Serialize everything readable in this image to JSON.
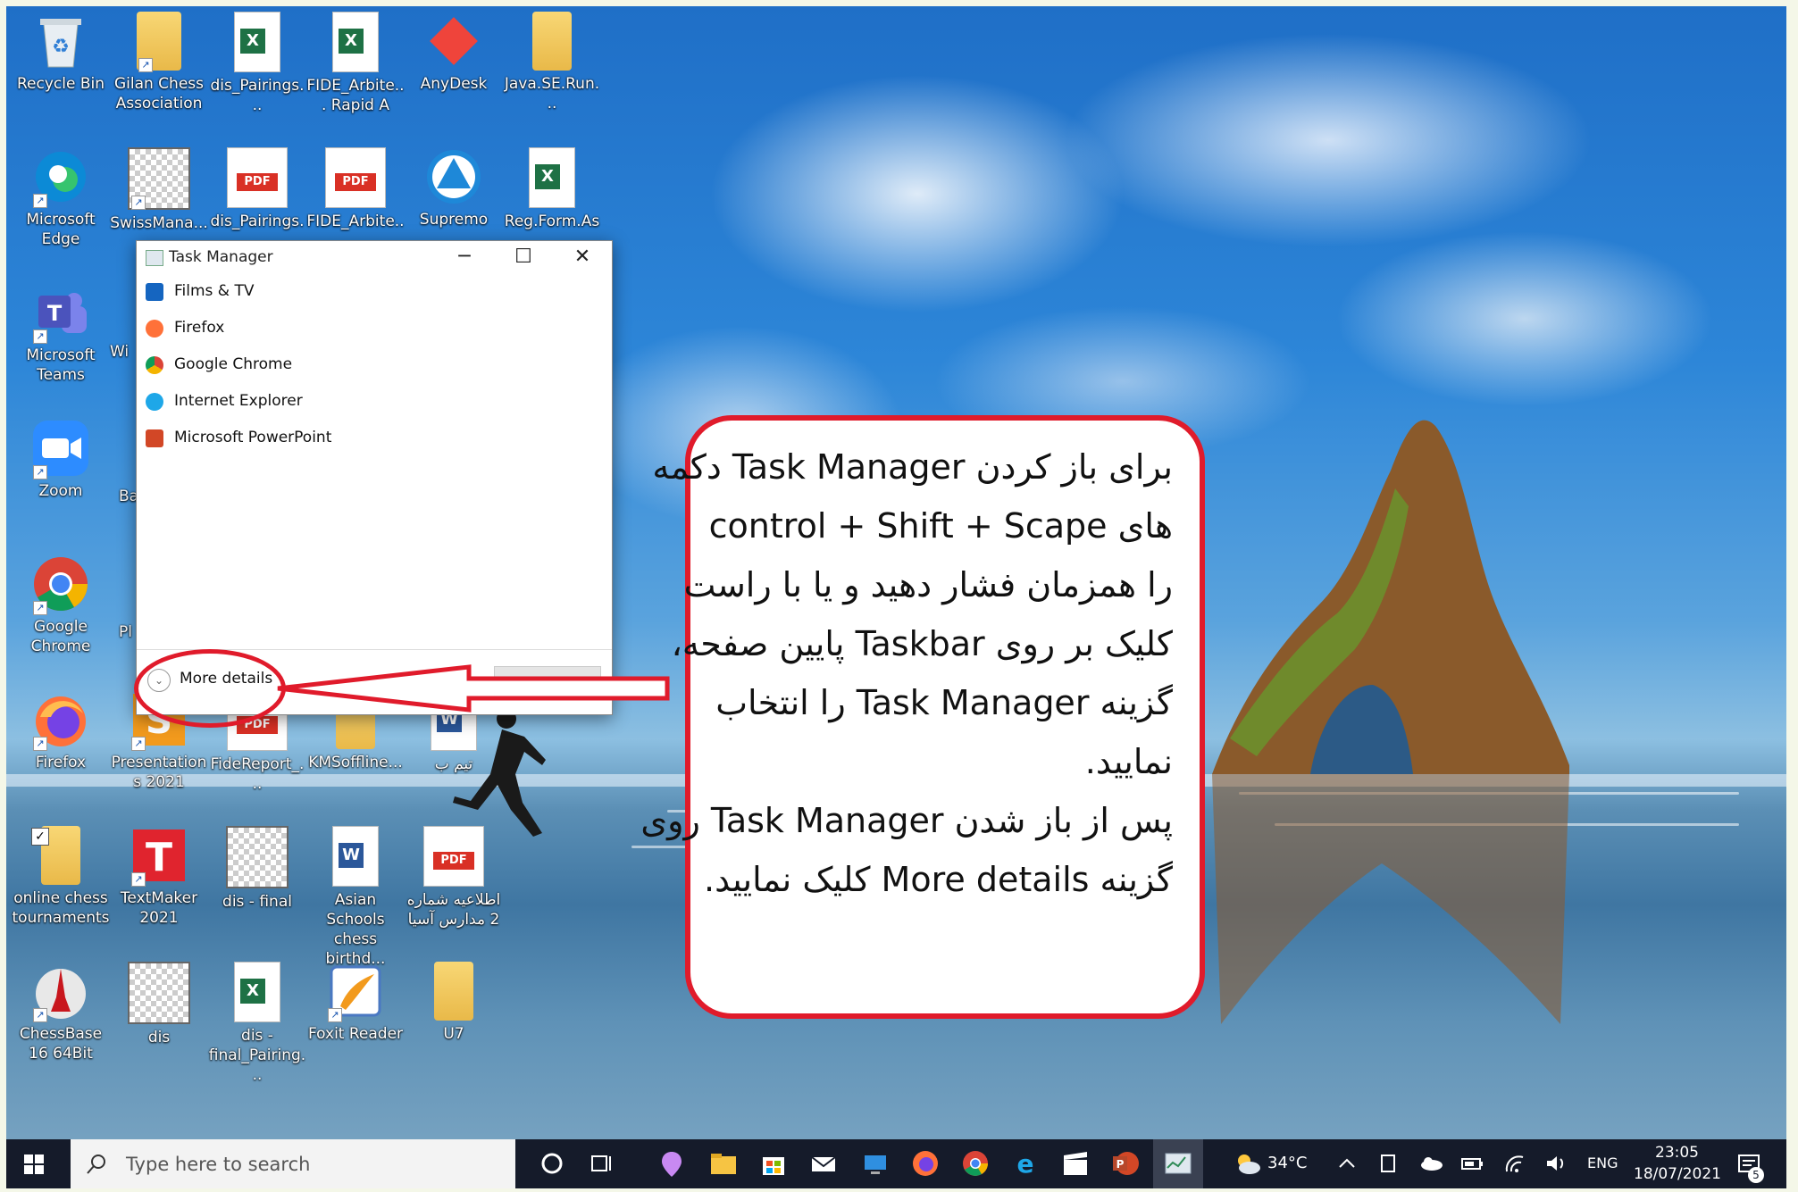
{
  "desktop": {
    "icons": [
      {
        "id": "recycle",
        "label": "Recycle Bin"
      },
      {
        "id": "gilan",
        "label": "Gilan Chess Association"
      },
      {
        "id": "dis_pairings_xls",
        "label": "dis_Pairings..."
      },
      {
        "id": "fide_xls",
        "label": "FIDE_Arbite... Rapid A"
      },
      {
        "id": "anydesk",
        "label": "AnyDesk"
      },
      {
        "id": "javase",
        "label": "Java.SE.Run..."
      },
      {
        "id": "edge",
        "label": "Microsoft Edge"
      },
      {
        "id": "swiss",
        "label": "SwissMana..."
      },
      {
        "id": "dis_pairings_pdf",
        "label": "dis_Pairings..."
      },
      {
        "id": "fide_pdf",
        "label": "FIDE_Arbite..."
      },
      {
        "id": "supremo",
        "label": "Supremo"
      },
      {
        "id": "regform",
        "label": "Reg.Form.As..."
      },
      {
        "id": "teams",
        "label": "Microsoft Teams"
      },
      {
        "id": "teams_partial",
        "label": "Wi"
      },
      {
        "id": "zoom",
        "label": "Zoom"
      },
      {
        "id": "zoom_partial",
        "label": "Ba"
      },
      {
        "id": "chrome",
        "label": "Google Chrome"
      },
      {
        "id": "chrome_partial",
        "label": "Pl"
      },
      {
        "id": "firefox",
        "label": "Firefox"
      },
      {
        "id": "presentations",
        "label": "Presentations 2021"
      },
      {
        "id": "fidereport",
        "label": "FideReport_..."
      },
      {
        "id": "kmsoffline",
        "label": "KMSoffline..."
      },
      {
        "id": "word_team",
        "label": "تیم ب"
      },
      {
        "id": "onlinechess",
        "label": "online chess tournaments"
      },
      {
        "id": "textmaker",
        "label": "TextMaker 2021"
      },
      {
        "id": "dis_final",
        "label": "dis - final"
      },
      {
        "id": "asian",
        "label": "Asian Schools chess birthd..."
      },
      {
        "id": "announce",
        "label": "اطلاعیه شماره 2 مدارس آسیا"
      },
      {
        "id": "chessbase",
        "label": "ChessBase 16 64Bit"
      },
      {
        "id": "dis",
        "label": "dis"
      },
      {
        "id": "dis_final_pairing",
        "label": "dis - final_Pairing..."
      },
      {
        "id": "foxit",
        "label": "Foxit Reader"
      },
      {
        "id": "u7",
        "label": "U7"
      }
    ]
  },
  "task_manager": {
    "title": "Task Manager",
    "minimize": "─",
    "maximize": "☐",
    "close": "✕",
    "apps": [
      {
        "name": "Films & TV",
        "color": "#1565c0"
      },
      {
        "name": "Firefox",
        "color": "#ff7139"
      },
      {
        "name": "Google Chrome",
        "color": "#34a853"
      },
      {
        "name": "Internet Explorer",
        "color": "#1ea7e8"
      },
      {
        "name": "Microsoft PowerPoint",
        "color": "#d24726"
      }
    ],
    "more_details": "More details"
  },
  "callout": {
    "lines": [
      "برای باز کردن Task Manager دکمه",
      "های control + Shift + Scape",
      "را همزمان فشار دهید و یا با راست",
      "کلیک بر روی Taskbar پایین صفحه،",
      "گزینه Task Manager را انتخاب",
      "نمایید.",
      "پس از باز شدن Task Manager روی",
      "گزینه More details کلیک نمایید."
    ]
  },
  "taskbar": {
    "search_placeholder": "Type here to search",
    "weather": "34°C",
    "language": "ENG",
    "time": "23:05",
    "date": "18/07/2021",
    "notifications": "5"
  },
  "colors": {
    "accent_red": "#e01b2b",
    "taskbar": "#151b2a"
  }
}
